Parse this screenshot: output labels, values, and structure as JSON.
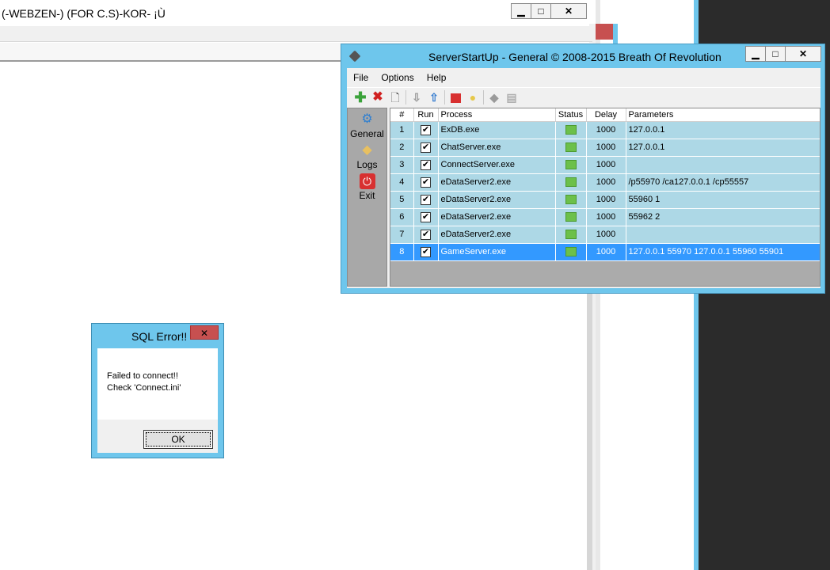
{
  "main_window": {
    "title": "(-WEBZEN-)  (FOR C.S)-KOR- ¡Ù",
    "minimize": "▁",
    "maximize": "□",
    "close": "✕"
  },
  "serverstartup": {
    "title": "ServerStartUp - General © 2008-2015 Breath Of Revolution",
    "minimize": "▁",
    "maximize": "□",
    "close": "✕",
    "menu": [
      "File",
      "Options",
      "Help"
    ],
    "toolbar_icons": [
      "add-icon",
      "delete-icon",
      "new-document-icon",
      "move-down-icon",
      "move-up-icon",
      "stop-icon",
      "lightbulb-icon",
      "back-icon",
      "copy-icon"
    ],
    "sidebar": [
      {
        "label": "General",
        "icon": "gears-icon"
      },
      {
        "label": "Logs",
        "icon": "logs-icon"
      },
      {
        "label": "Exit",
        "icon": "power-icon"
      }
    ],
    "columns": [
      "#",
      "Run",
      "Process",
      "Status",
      "Delay",
      "Parameters"
    ],
    "rows": [
      {
        "num": "1",
        "run": "✔",
        "process": "ExDB.exe",
        "delay": "1000",
        "params": "127.0.0.1"
      },
      {
        "num": "2",
        "run": "✔",
        "process": "ChatServer.exe",
        "delay": "1000",
        "params": "127.0.0.1"
      },
      {
        "num": "3",
        "run": "✔",
        "process": "ConnectServer.exe",
        "delay": "1000",
        "params": ""
      },
      {
        "num": "4",
        "run": "✔",
        "process": "eDataServer2.exe",
        "delay": "1000",
        "params": "/p55970 /ca127.0.0.1 /cp55557"
      },
      {
        "num": "5",
        "run": "✔",
        "process": "eDataServer2.exe",
        "delay": "1000",
        "params": "55960 1"
      },
      {
        "num": "6",
        "run": "✔",
        "process": "eDataServer2.exe",
        "delay": "1000",
        "params": "55962 2"
      },
      {
        "num": "7",
        "run": "✔",
        "process": "eDataServer2.exe",
        "delay": "1000",
        "params": ""
      },
      {
        "num": "8",
        "run": "✔",
        "process": "GameServer.exe",
        "delay": "1000",
        "params": "127.0.0.1 55970 127.0.0.1 55960 55901"
      }
    ],
    "selected_row": 8
  },
  "sql_error": {
    "title": "SQL Error!!",
    "close": "✕",
    "line1": "Failed to connect!!",
    "line2": "Check 'Connect.ini'",
    "ok": "OK"
  },
  "colors": {
    "window_border": "#6ec6ec",
    "row_bg": "#add8e6",
    "selected_row": "#3399ff",
    "status_led": "#6cc04a",
    "close_red": "#c75050"
  }
}
